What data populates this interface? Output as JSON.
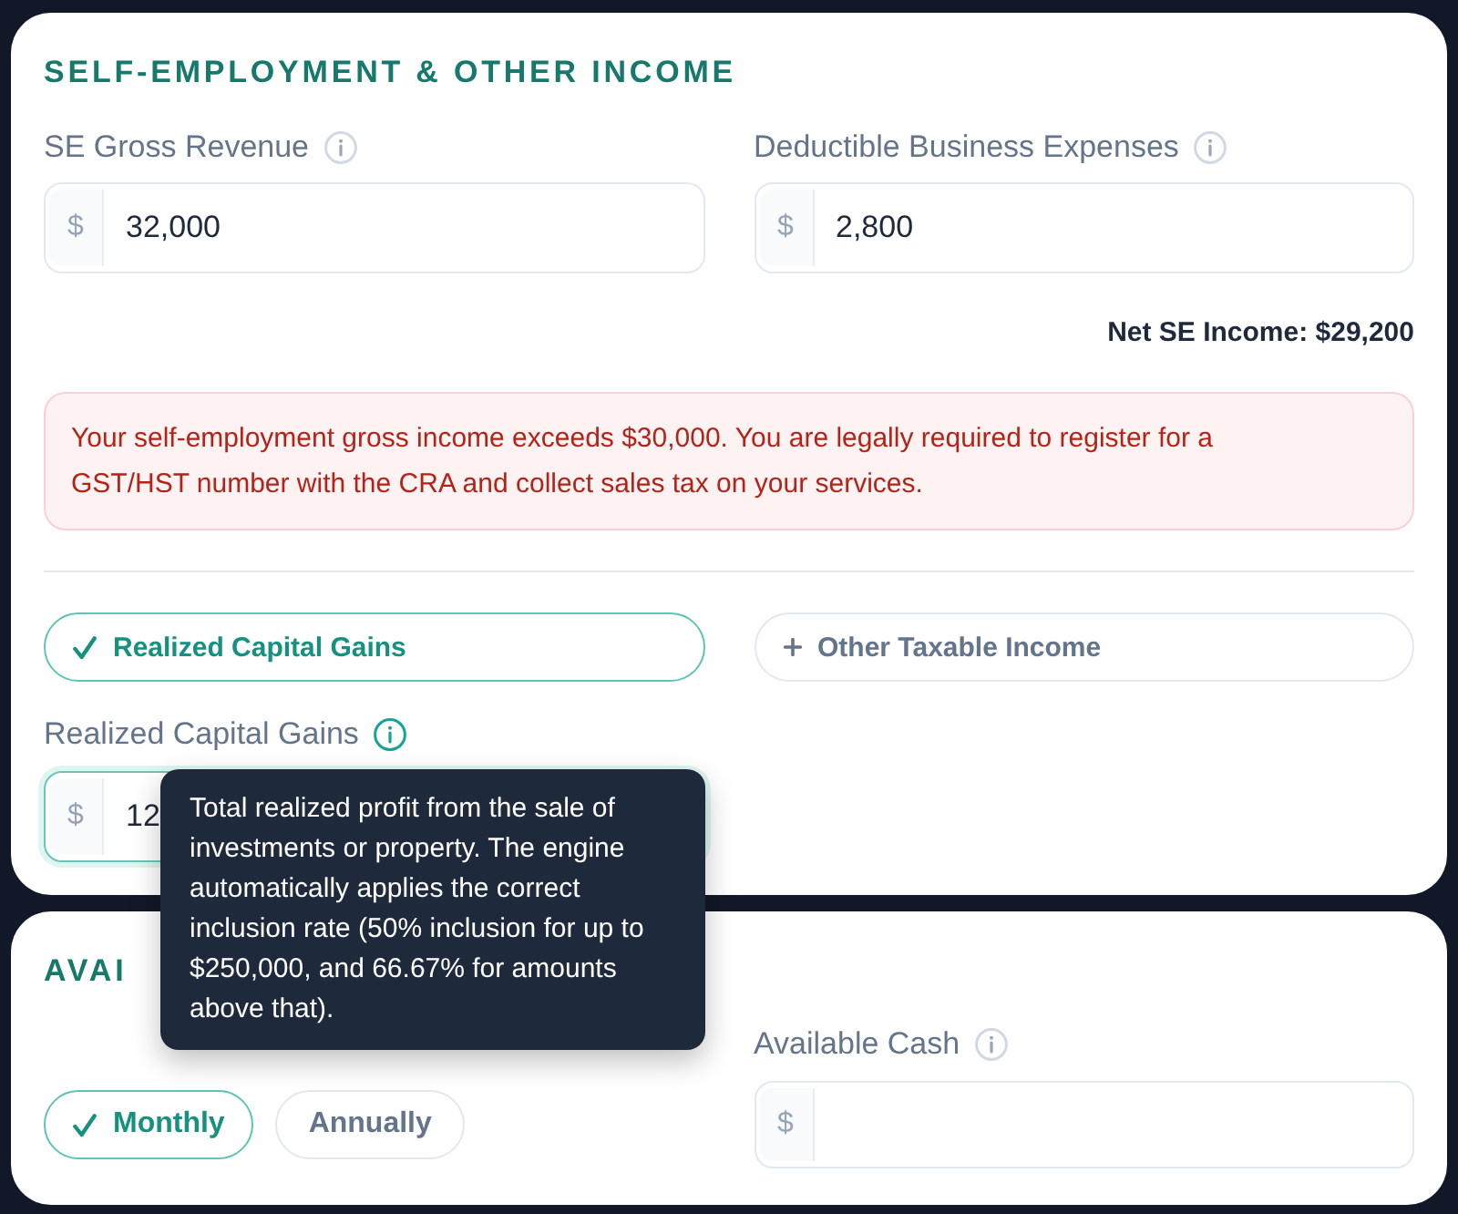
{
  "income_section": {
    "title": "SELF-EMPLOYMENT & OTHER INCOME",
    "fields": [
      {
        "label": "SE Gross Revenue",
        "prefix": "$",
        "value": "32,000"
      },
      {
        "label": "Deductible Business Expenses",
        "prefix": "$",
        "value": "2,800"
      }
    ],
    "net_income": "Net SE Income: $29,200",
    "alert": {
      "kind": "error",
      "text": "Your self-employment gross income exceeds $30,000. You are legally required to register for a GST/HST number with the CRA and collect sales tax on your services."
    },
    "income_toggles": [
      {
        "label": "Realized Capital Gains",
        "selected": true
      },
      {
        "label": "Other Taxable Income",
        "selected": false
      }
    ],
    "capital_gains": {
      "label": "Realized Capital Gains",
      "prefix": "$",
      "value": "12",
      "focused": true,
      "tooltip": "Total realized profit from the sale of investments or property. The engine automatically applies the correct inclusion rate (50% inclusion for up to $250,000, and 66.67% for amounts above that)."
    }
  },
  "cash_section": {
    "title": "AVAI",
    "frequency": [
      {
        "label": "Monthly",
        "selected": true
      },
      {
        "label": "Annually",
        "selected": false
      }
    ],
    "cash_field": {
      "label": "Available Cash",
      "prefix": "$"
    }
  }
}
